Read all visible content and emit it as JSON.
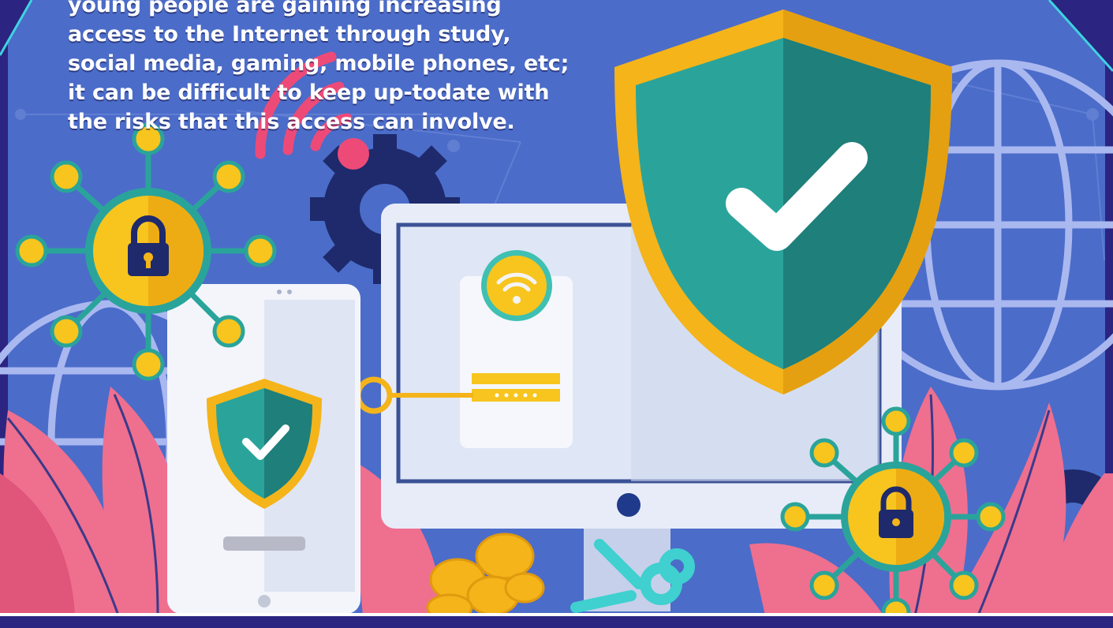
{
  "intro_text": {
    "lines": [
      "young people are gaining increasing",
      "access to the Internet through study,",
      "social media, gaming, mobile phones, etc;",
      "it can be difficult to keep up-todate with",
      "the risks that this access can involve."
    ]
  },
  "colors": {
    "background": "#4b6cc9",
    "frame": "#2b2480",
    "shield_teal": "#2aa49a",
    "shield_dark_teal": "#1f7f7a",
    "shield_gold": "#f4b41a",
    "leaf_pink": "#ef6f8f",
    "yellow": "#f7c51e",
    "monitor_white": "#eef2fb",
    "wifi_pink": "#ee4a78"
  },
  "icons": [
    "large-shield-check-icon",
    "phone-shield-check-icon",
    "padlock-network-icon",
    "wifi-icon",
    "gear-icon",
    "globe-icon",
    "key-icon",
    "coins-icon",
    "leaf-icon"
  ]
}
